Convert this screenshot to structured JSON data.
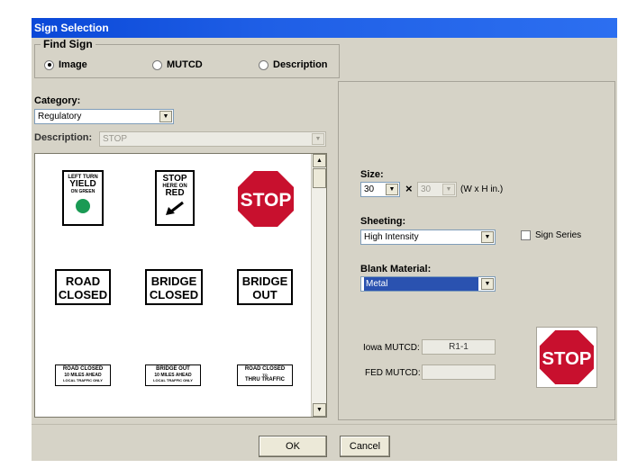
{
  "window": {
    "title": "Sign Selection"
  },
  "find_sign": {
    "legend": "Find Sign",
    "options": [
      {
        "label": "Image",
        "selected": true
      },
      {
        "label": "MUTCD",
        "selected": false
      },
      {
        "label": "Description",
        "selected": false
      }
    ]
  },
  "category": {
    "label": "Category:",
    "value": "Regulatory"
  },
  "description": {
    "label": "Description:",
    "value": "STOP"
  },
  "signs": {
    "yield_green": {
      "line1": "LEFT TURN",
      "line2": "YIELD",
      "line3": "ON GREEN"
    },
    "stop_here": {
      "line1": "STOP",
      "line2": "HERE ON",
      "line3": "RED"
    },
    "stop": {
      "text": "STOP"
    },
    "road_closed": {
      "line1": "ROAD",
      "line2": "CLOSED"
    },
    "bridge_closed": {
      "line1": "BRIDGE",
      "line2": "CLOSED"
    },
    "bridge_out": {
      "line1": "BRIDGE",
      "line2": "OUT"
    },
    "road_closed_miles": {
      "line1": "ROAD CLOSED",
      "line2": "10 MILES AHEAD",
      "line3": "LOCAL TRAFFIC ONLY"
    },
    "bridge_out_miles": {
      "line1": "BRIDGE OUT",
      "line2": "10 MILES AHEAD",
      "line3": "LOCAL TRAFFIC ONLY"
    },
    "road_closed_thru": {
      "line1": "ROAD CLOSED",
      "line2": "TO",
      "line3": "THRU TRAFFIC"
    }
  },
  "size": {
    "label": "Size:",
    "width": "30",
    "height": "30",
    "times": "×",
    "unit": "(W x H in.)"
  },
  "sheeting": {
    "label": "Sheeting:",
    "value": "High Intensity"
  },
  "sign_series": {
    "label": "Sign Series"
  },
  "blank_material": {
    "label": "Blank Material:",
    "value": "Metal"
  },
  "iowa_mutcd": {
    "label": "Iowa MUTCD:",
    "value": "R1-1"
  },
  "fed_mutcd": {
    "label": "FED MUTCD:",
    "value": ""
  },
  "preview": {
    "text": "STOP"
  },
  "buttons": {
    "ok": "OK",
    "cancel": "Cancel"
  },
  "colors": {
    "stop_red": "#c8102e",
    "green": "#1a9a54",
    "selection": "#2a52b0"
  }
}
